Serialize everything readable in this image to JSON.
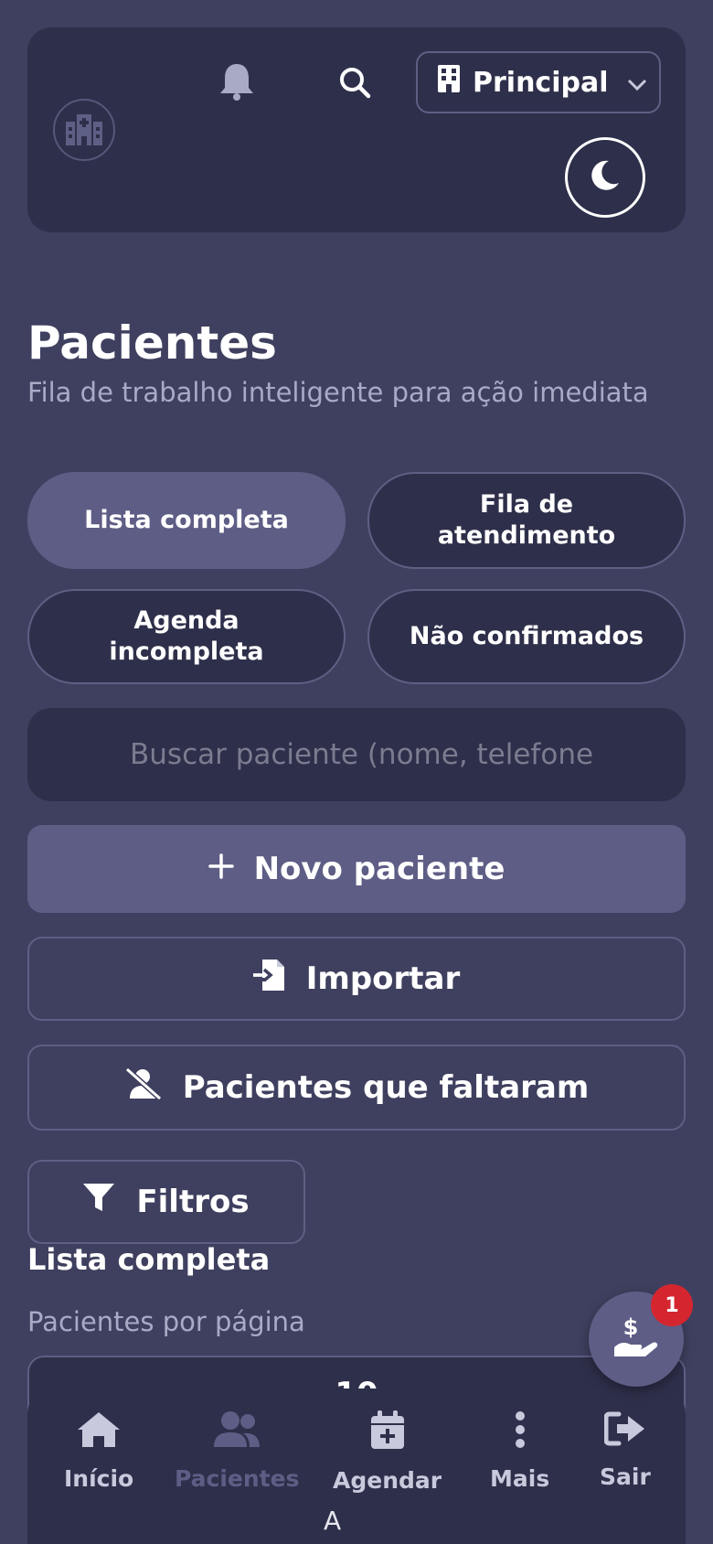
{
  "header": {
    "unit_select": {
      "label": "Principal"
    },
    "icons": {
      "logo": "hospital-icon",
      "bell": "bell-icon",
      "search": "search-icon",
      "building": "building-icon",
      "chevron": "chevron-down-icon",
      "theme": "moon-icon"
    }
  },
  "page": {
    "title": "Pacientes",
    "subtitle": "Fila de trabalho inteligente para ação imediata"
  },
  "tabs": [
    {
      "label": "Lista completa",
      "active": true
    },
    {
      "label": "Fila de atendimento",
      "active": false
    },
    {
      "label": "Agenda incompleta",
      "active": false
    },
    {
      "label": "Não confirmados",
      "active": false
    }
  ],
  "search": {
    "placeholder": "Buscar paciente (nome, telefone"
  },
  "actions": {
    "new_patient": "Novo paciente",
    "import": "Importar",
    "missed": "Pacientes que faltaram",
    "filters": "Filtros"
  },
  "list": {
    "section_title": "Lista completa",
    "per_page_label": "Pacientes por página",
    "per_page_value": "10"
  },
  "fab": {
    "icon": "hand-dollar-icon",
    "badge": "1"
  },
  "bottom_nav": [
    {
      "label": "Início",
      "icon": "home-icon",
      "active": false
    },
    {
      "label": "Pacientes",
      "icon": "users-icon",
      "active": true
    },
    {
      "label": "Agendar",
      "icon": "calendar-plus-icon",
      "active": false
    },
    {
      "label": "Mais",
      "icon": "more-vertical-icon",
      "active": false
    },
    {
      "label": "Sair",
      "icon": "logout-icon",
      "active": false
    }
  ],
  "bottom_letter": "A",
  "colors": {
    "background": "#3f405f",
    "surface": "#2e2f4a",
    "accent": "#5e5d86",
    "badge": "#d5262f",
    "muted_text": "#a9aac6"
  }
}
